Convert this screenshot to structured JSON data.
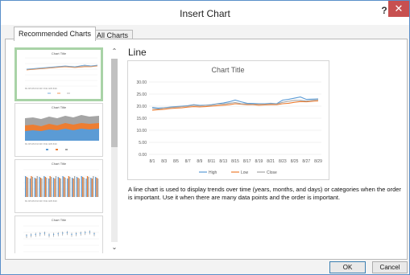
{
  "window": {
    "title": "Insert Chart",
    "help_label": "?",
    "close_label": "✕"
  },
  "tabs": [
    {
      "label": "Recommended Charts",
      "active": true
    },
    {
      "label": "All Charts",
      "active": false
    }
  ],
  "thumbnails": [
    {
      "title": "Chart Title",
      "kind": "line",
      "selected": true
    },
    {
      "title": "Chart Title",
      "kind": "stacked-area",
      "selected": false
    },
    {
      "title": "Chart Title",
      "kind": "clustered-column",
      "selected": false
    },
    {
      "title": "Chart Title",
      "kind": "line-markers",
      "selected": false
    }
  ],
  "scrollbar": {
    "up_icon": "chevron-up-icon",
    "down_icon": "chevron-down-icon",
    "up_glyph": "⌃",
    "down_glyph": "⌄"
  },
  "detail": {
    "chart_type": "Line",
    "description": "A line chart is used to display trends over time (years, months, and days) or categories when the order is important. Use it when there are many data points and the order is important."
  },
  "buttons": {
    "ok": "OK",
    "cancel": "Cancel"
  },
  "colors": {
    "high": "#5b9bd5",
    "low": "#ed7d31",
    "close": "#a5a5a5",
    "selected_border": "#a9d3a7",
    "close_button": "#c75050"
  },
  "chart_data": {
    "type": "line",
    "title": "Chart Title",
    "categories": [
      "8/1",
      "8/2",
      "8/3",
      "8/4",
      "8/5",
      "8/6",
      "8/7",
      "8/8",
      "8/9",
      "8/10",
      "8/11",
      "8/12",
      "8/13",
      "8/14",
      "8/15",
      "8/16",
      "8/17",
      "8/18",
      "8/19",
      "8/20",
      "8/21",
      "8/22",
      "8/23",
      "8/24",
      "8/25",
      "8/26",
      "8/27",
      "8/28",
      "8/29"
    ],
    "tick_labels": [
      "8/1",
      "8/3",
      "8/5",
      "8/7",
      "8/9",
      "8/11",
      "8/13",
      "8/15",
      "8/17",
      "8/19",
      "8/21",
      "8/23",
      "8/25",
      "8/27",
      "8/29"
    ],
    "ylim": [
      0,
      30
    ],
    "yticks": [
      "30.00",
      "25.00",
      "20.00",
      "15.00",
      "10.00",
      "5.00",
      "0.00"
    ],
    "series": [
      {
        "name": "High",
        "values": [
          19.5,
          19.2,
          19.3,
          19.6,
          19.8,
          20.0,
          20.2,
          20.6,
          20.3,
          20.4,
          20.6,
          21.0,
          21.3,
          21.8,
          22.5,
          21.8,
          21.2,
          21.1,
          21.0,
          21.0,
          21.2,
          21.0,
          22.5,
          22.8,
          23.3,
          23.8,
          22.8,
          22.9,
          23.0
        ]
      },
      {
        "name": "Low",
        "values": [
          18.3,
          18.5,
          18.7,
          19.0,
          19.2,
          19.3,
          19.6,
          19.8,
          19.7,
          19.8,
          20.0,
          20.2,
          20.4,
          20.6,
          21.0,
          20.8,
          20.6,
          20.6,
          20.4,
          20.5,
          20.6,
          20.6,
          21.0,
          21.2,
          21.6,
          21.9,
          21.8,
          22.0,
          22.2
        ]
      },
      {
        "name": "Close",
        "values": [
          19.0,
          18.8,
          19.2,
          19.4,
          19.6,
          19.8,
          20.0,
          20.4,
          20.1,
          20.3,
          20.4,
          20.8,
          20.9,
          21.2,
          21.5,
          21.0,
          20.9,
          20.8,
          20.8,
          20.8,
          21.0,
          20.9,
          21.6,
          22.0,
          22.4,
          22.4,
          22.1,
          22.4,
          22.7
        ]
      }
    ],
    "legend": "bottom",
    "grid": true
  }
}
